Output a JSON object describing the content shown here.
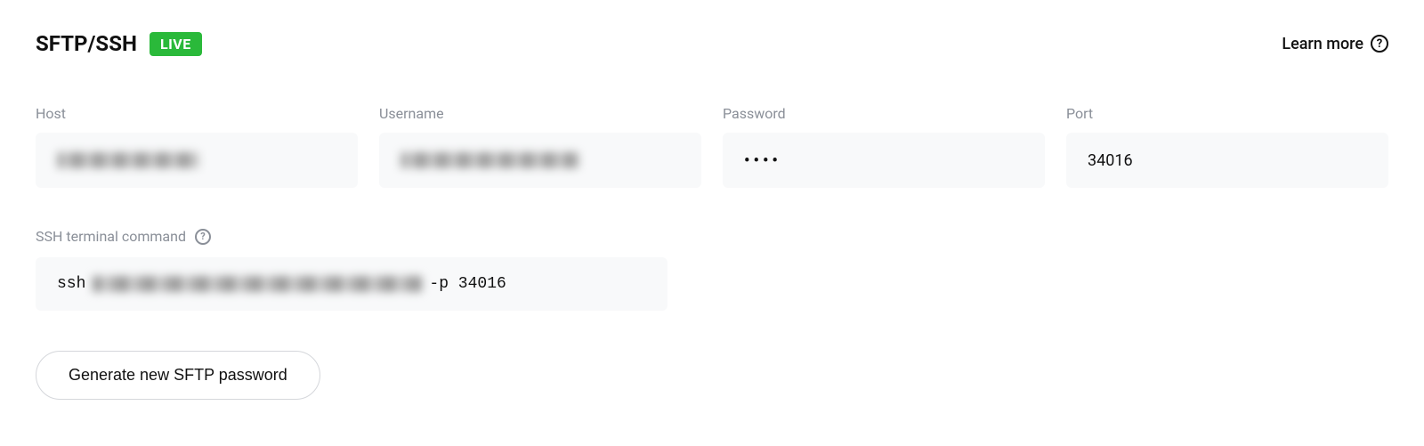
{
  "header": {
    "title": "SFTP/SSH",
    "badge": "LIVE",
    "learn_more": "Learn more"
  },
  "fields": {
    "host": {
      "label": "Host",
      "value": ""
    },
    "username": {
      "label": "Username",
      "value": ""
    },
    "password": {
      "label": "Password",
      "value": "••••"
    },
    "port": {
      "label": "Port",
      "value": "34016"
    }
  },
  "ssh": {
    "label": "SSH terminal command",
    "prefix": "ssh",
    "suffix": "-p 34016"
  },
  "actions": {
    "generate_password": "Generate new SFTP password"
  }
}
